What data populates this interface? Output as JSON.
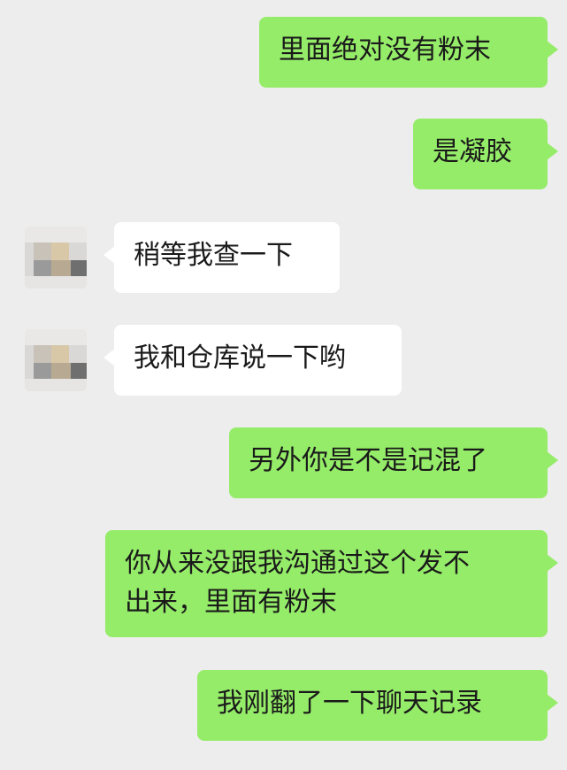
{
  "chat": {
    "messages": [
      {
        "from": "self",
        "text": "里面绝对没有粉末"
      },
      {
        "from": "self",
        "text": "是凝胶"
      },
      {
        "from": "other",
        "text": "稍等我查一下"
      },
      {
        "from": "other",
        "text": "我和仓库说一下哟"
      },
      {
        "from": "self",
        "text": "另外你是不是记混了"
      },
      {
        "from": "self",
        "text_line1": "你从来没跟我沟通过这个发不",
        "text_line2": "出来，里面有粉末"
      },
      {
        "from": "self",
        "text": "我刚翻了一下聊天记录"
      }
    ]
  },
  "colors": {
    "background": "#ededed",
    "sent_bubble": "#95ec69",
    "received_bubble": "#ffffff",
    "text": "#1a1a1a"
  },
  "icons": {
    "avatar": "avatar-icon (pixelated)"
  }
}
